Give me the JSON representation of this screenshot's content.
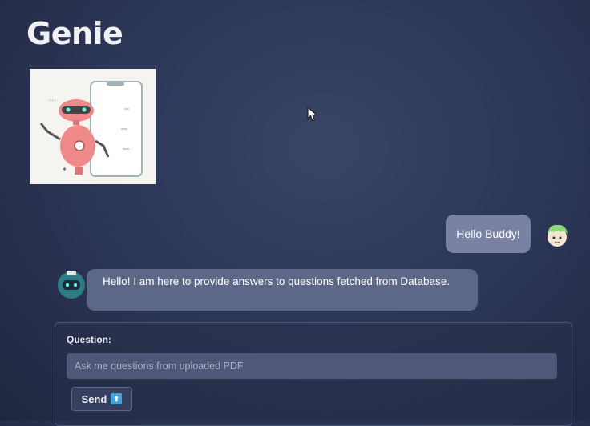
{
  "app": {
    "title": "Genie"
  },
  "chat": {
    "user_message": "Hello Buddy!",
    "bot_message": "Hello! I am here to provide answers to questions fetched from Database."
  },
  "form": {
    "label": "Question:",
    "placeholder": "Ask me questions from uploaded PDF",
    "send_label": "Send",
    "send_icon": "upload-icon"
  },
  "colors": {
    "background": "#2f3a5c",
    "user_bubble": "#7a82a3",
    "bot_bubble": "#5d6788",
    "input": "#4f5878",
    "send_icon_accent": "#3fa4dc"
  }
}
